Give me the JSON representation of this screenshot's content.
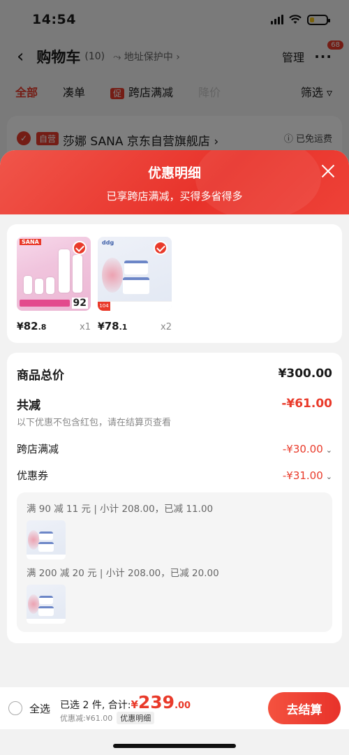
{
  "status_bar": {
    "time": "14:54"
  },
  "cart_page": {
    "title": "购物车",
    "count": "(10)",
    "address_protect": "⤳ 地址保护中 ›",
    "manage": "管理",
    "more": "···",
    "message_badge": "68",
    "filters": [
      {
        "label": "全部"
      },
      {
        "label": "凑单"
      },
      {
        "tag": "促",
        "label": "跨店满减"
      },
      {
        "label": "降价"
      }
    ],
    "filter_right": "筛选 ▿",
    "store": {
      "tag": "自营",
      "name": "莎娜 SANA 京东自营旗舰店",
      "chevron": "›",
      "shipping": "ⓘ 已免运费"
    }
  },
  "sheet": {
    "title": "优惠明细",
    "subtitle": "已享跨店满减，买得多省得多",
    "products": [
      {
        "price_symbol": "¥",
        "price_int": "82",
        "price_dec": ".8",
        "qty": "x1",
        "img_brand": "SANA",
        "img_price": "92"
      },
      {
        "price_symbol": "¥",
        "price_int": "78",
        "price_dec": ".1",
        "qty": "x2",
        "img_brand": "ddg"
      }
    ],
    "total_label": "商品总价",
    "total_value": "¥300.00",
    "reduce_label": "共减",
    "reduce_value": "-¥61.00",
    "reduce_note": "以下优惠不包含红包，请在结算页查看",
    "cross_label": "跨店满减",
    "cross_value": "-¥30.00",
    "coupon_label": "优惠券",
    "coupon_value": "-¥31.00",
    "chevron": "⌄",
    "coupon_lines": [
      "满 90 减 11 元 | 小计 208.00，已减 11.00",
      "满 200 减 20 元 | 小计 208.00，已减 20.00"
    ]
  },
  "checkout": {
    "select_all": "全选",
    "selected_label": "已选 2 件, 合计:",
    "sum_symbol": "¥",
    "sum_int": "239",
    "sum_dec": ".00",
    "discount_text": "优惠减:¥61.00",
    "detail_chip": "优惠明细",
    "button": "去结算"
  },
  "colors": {
    "accent": "#e93a2a",
    "header_gradient_start": "#f0554a",
    "header_gradient_end": "#e8322a"
  }
}
